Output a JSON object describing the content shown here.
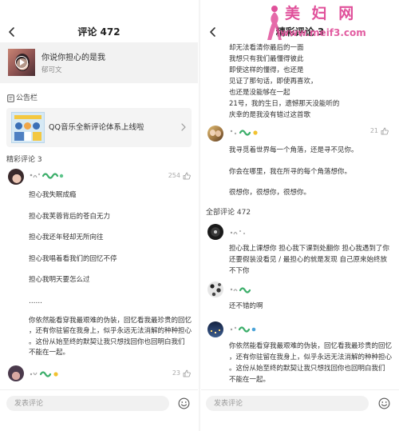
{
  "left_panel": {
    "header": {
      "title": "评论 472"
    },
    "song": {
      "title": "你说你担心的是我",
      "artist": "郁可文"
    },
    "notice": {
      "label": "公告栏",
      "text": "QQ音乐全新评论体系上线啦"
    },
    "featured_label": "精彩评论 3",
    "comments": [
      {
        "likes": "254",
        "lines": [
          "担心我失眠成瘾",
          "担心我芙蓉背后的苍白无力",
          "担心我还年轻却无所向往",
          "担心我唱着看我们的回忆不停",
          "担心我明天要怎么过",
          "……",
          "你依然能看穿我最艰难的伪装，回忆看我最珍贵的回忆",
          "，还有你驻留在我身上，似乎永远无法消解的种种担心",
          "。这份从始至终的默契让我只想找回你也回明白我们",
          "不能在一起。"
        ]
      },
      {
        "likes": "23"
      }
    ],
    "composer": {
      "placeholder": "发表评论"
    }
  },
  "right_panel": {
    "header": {
      "title": "精彩评论 3"
    },
    "continued_lines": [
      "却无法看清你最后的一面",
      "我想只有我们最懂得彼此",
      "即使这样的懂得，也还是",
      "见证了那句话，即使再喜欢，",
      "也还是没能够在一起",
      "21号，我的生日，遗憾那天没能听的",
      "庆幸的是我没有错过这首歌"
    ],
    "featured_comment": {
      "likes": "21",
      "lines": [
        "我寻觅着世界每一个角落，还是寻不见你。",
        "你会在哪里，我在所寻的每个角落想你。",
        "很想你，很想你，很想你。"
      ]
    },
    "all_label": "全部评论 472",
    "comments": [
      {
        "lines": [
          "担心我上课想你 担心我下课到处翻你 担心我遇到了你",
          "还要假装没看见 / 最担心的就是发现 自己原来始终放",
          "不下你"
        ]
      },
      {
        "lines": [
          "还不错的啊"
        ]
      },
      {
        "lines": [
          "你依然能看穿我最艰难的伪装，回忆看我最珍贵的回忆",
          "，还有你驻留在我身上，似乎永远无法消解的种种担心",
          "。这份从始至终的默契让我只想找回你也回明白我们",
          "不能在一起。"
        ]
      }
    ],
    "composer": {
      "placeholder": "发表评论"
    }
  },
  "watermark": {
    "name": "美 妇 网",
    "url": "www.meif3.com"
  },
  "icons": {
    "back": "chevron-left-icon",
    "play": "play-icon",
    "notice": "notice-icon",
    "chevron": "chevron-right-icon",
    "like": "thumb-up-icon",
    "emoji": "emoji-icon"
  },
  "colors": {
    "text": "#333333",
    "muted": "#999999",
    "card_background": "#f2f2f2",
    "watermark_pink": "#e0509a"
  }
}
